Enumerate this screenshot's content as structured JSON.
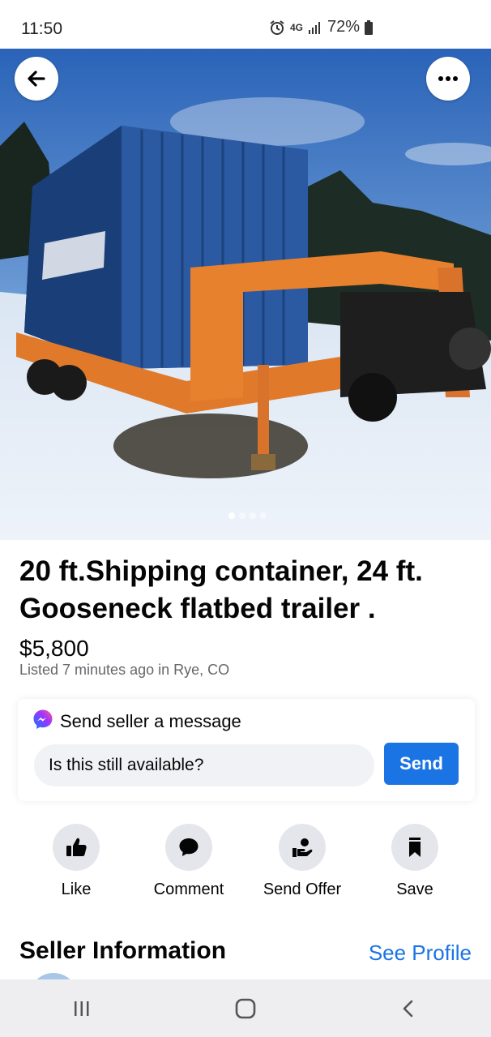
{
  "status_bar": {
    "time": "11:50",
    "network": "4G",
    "battery": "72%"
  },
  "hero": {
    "image_count": 4,
    "active_index": 0,
    "back_icon": "arrow-left-icon",
    "more_icon": "more-horizontal-icon"
  },
  "listing": {
    "title": "20 ft.Shipping container, 24 ft. Gooseneck flatbed trailer .",
    "price": "$5,800",
    "listed": "Listed 7 minutes ago in Rye, CO"
  },
  "message": {
    "header": "Send seller a message",
    "input_value": "Is this still available?",
    "send_label": "Send",
    "accent": "#1b74e4"
  },
  "actions": [
    {
      "label": "Like",
      "icon": "thumbs-up-icon"
    },
    {
      "label": "Comment",
      "icon": "comment-icon"
    },
    {
      "label": "Send Offer",
      "icon": "send-offer-icon"
    },
    {
      "label": "Save",
      "icon": "bookmark-icon"
    }
  ],
  "seller": {
    "heading": "Seller Information",
    "link": "See Profile"
  },
  "nav": {
    "recent_icon": "recent-apps-icon",
    "home_icon": "home-icon",
    "back_icon": "back-chevron-icon"
  }
}
